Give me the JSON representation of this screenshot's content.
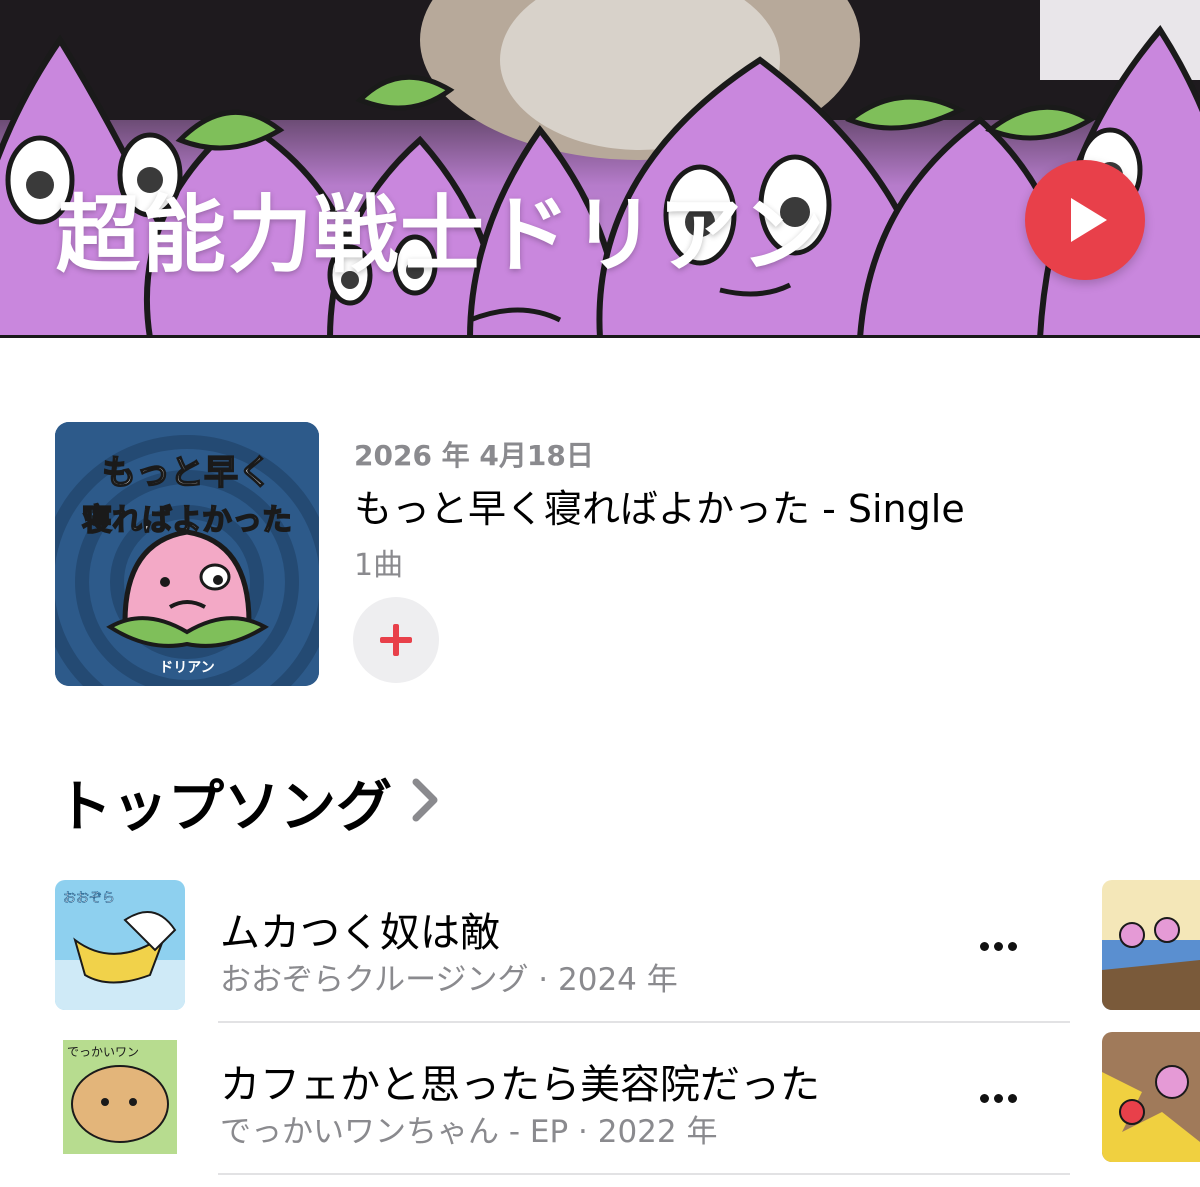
{
  "artist": {
    "name": "超能力戦士ドリアン"
  },
  "latest_release": {
    "date": "2026 年 4月18日",
    "title": "もっと早く寝ればよかった - Single",
    "track_count": "1曲",
    "cover_title": "もっと早く寝ればよかった",
    "cover_logo": "ドリアン"
  },
  "top_songs": {
    "heading": "トップソング",
    "songs": [
      {
        "title": "ムカつく奴は敵",
        "subtitle": "おおぞらクルージング · 2024 年",
        "cover_title": "おおぞらクルージング"
      },
      {
        "title": "カフェかと思ったら美容院だった",
        "subtitle": "でっかいワンちゃん - EP · 2022 年",
        "cover_title": "でっかいワンちゃん"
      }
    ]
  },
  "colors": {
    "accent": "#e8404a",
    "secondary_text": "#8a8a8e",
    "hero_purple": "#c890d8"
  },
  "icons": {
    "play": "play-icon",
    "add": "plus-icon",
    "chevron": "chevron-right-icon",
    "more": "ellipsis-icon"
  }
}
